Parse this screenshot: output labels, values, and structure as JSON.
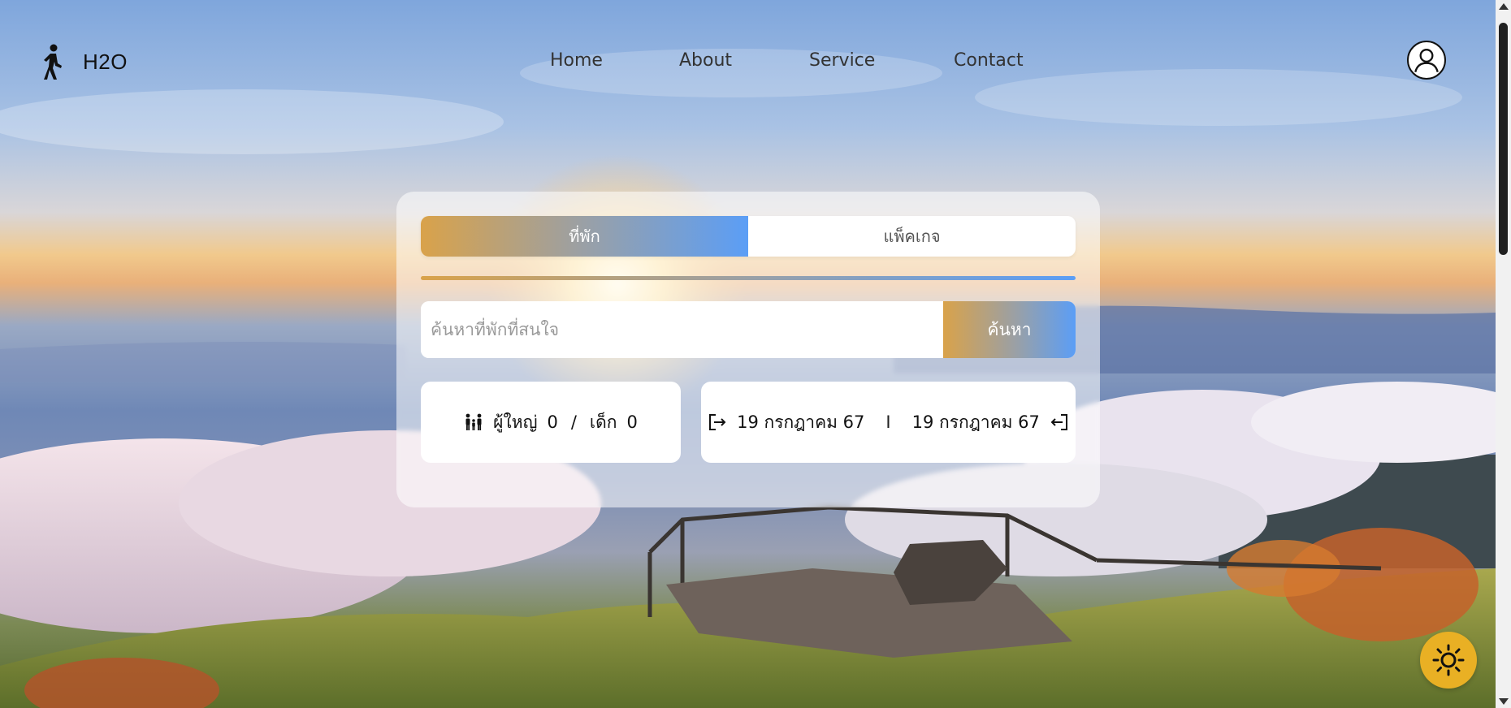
{
  "brand": {
    "name": "H2O",
    "logo_icon": "walking-person-icon"
  },
  "nav": {
    "items": [
      {
        "label": "Home"
      },
      {
        "label": "About"
      },
      {
        "label": "Service"
      },
      {
        "label": "Contact"
      }
    ]
  },
  "profile": {
    "icon": "user-profile-icon"
  },
  "search_card": {
    "tabs": [
      {
        "label": "ที่พัก",
        "active": true
      },
      {
        "label": "แพ็คเกจ",
        "active": false
      }
    ],
    "search": {
      "placeholder": "ค้นหาที่พักที่สนใจ",
      "value": "",
      "button_label": "ค้นหา"
    },
    "guests": {
      "icon": "family-icon",
      "adults_label": "ผู้ใหญ่",
      "adults_count": "0",
      "separator": "/",
      "children_label": "เด็ก",
      "children_count": "0"
    },
    "dates": {
      "checkin_icon": "checkin-arrow-icon",
      "checkin": "19 กรกฎาคม 67",
      "separator": "I",
      "checkout": "19 กรกฎาคม 67",
      "checkout_icon": "checkout-arrow-icon"
    }
  },
  "theme_toggle": {
    "icon": "sun-icon",
    "color": "#e9b024"
  },
  "colors": {
    "gradient_start": "#d9a24a",
    "gradient_mid": "#9aa0a6",
    "gradient_end": "#5b9ef6"
  }
}
